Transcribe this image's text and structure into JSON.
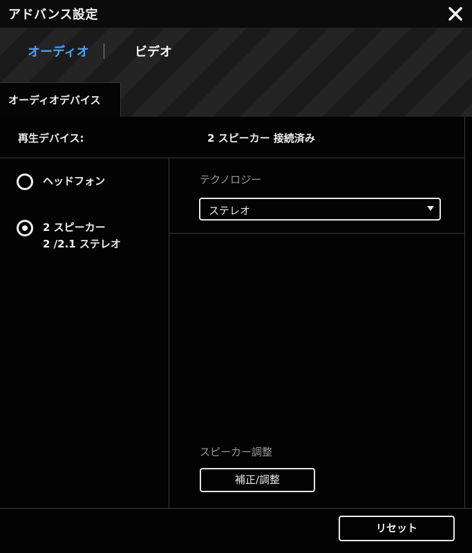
{
  "window": {
    "title": "アドバンス設定",
    "close_icon": "close-icon"
  },
  "tabs": [
    {
      "label": "オーディオ",
      "active": true
    },
    {
      "label": "ビデオ",
      "active": false
    }
  ],
  "subtab": {
    "label": "オーディオデバイス"
  },
  "playback_device": {
    "label": "再生デバイス:",
    "value": "2 スピーカー 接続済み"
  },
  "outputs": [
    {
      "label": "ヘッドフォン",
      "selected": false
    },
    {
      "label_line1": "2 スピーカー",
      "label_line2": "2 /2.1 ステレオ",
      "selected": true
    }
  ],
  "technology": {
    "label": "テクノロジー",
    "selected": "ステレオ"
  },
  "speaker_adjust": {
    "label": "スピーカー調整",
    "button": "補正/調整"
  },
  "footer": {
    "reset_label": "リセット"
  },
  "colors": {
    "accent": "#4aa3ff",
    "background": "#030303",
    "border": "#3a3a3a"
  }
}
